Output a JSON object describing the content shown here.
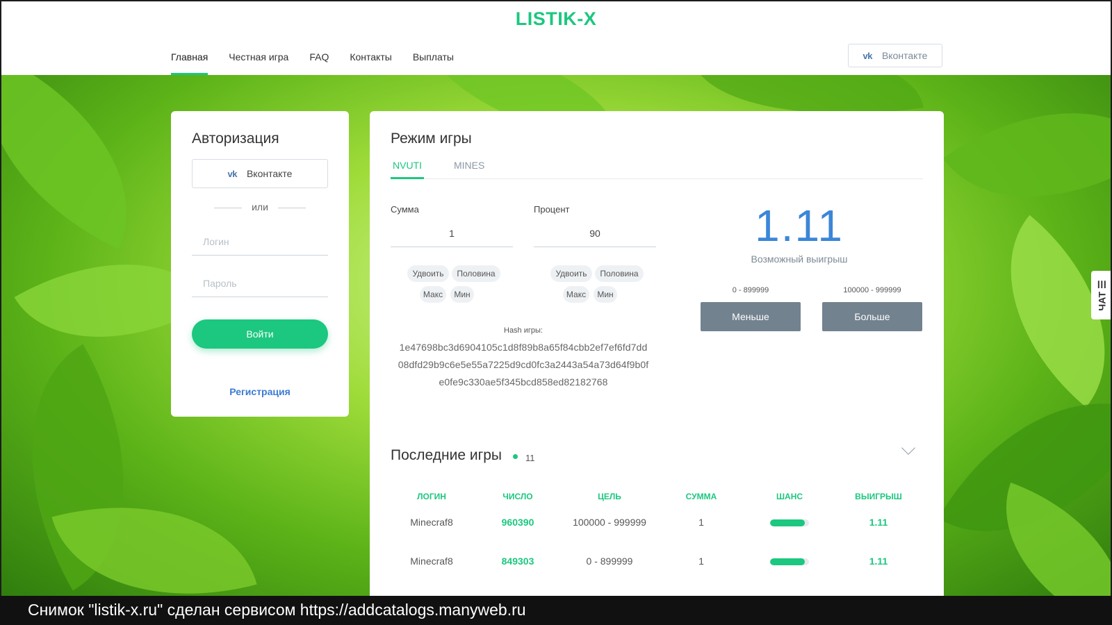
{
  "header": {
    "logo": "LISTIK-X",
    "nav": [
      "Главная",
      "Честная игра",
      "FAQ",
      "Контакты",
      "Выплаты"
    ],
    "vk_button": "Вконтакте",
    "vk_icon": "vk-icon"
  },
  "auth": {
    "title": "Авторизация",
    "vk_button": "Вконтакте",
    "or": "или",
    "login_placeholder": "Логин",
    "password_placeholder": "Пароль",
    "submit": "Войти",
    "register": "Регистрация"
  },
  "game": {
    "title": "Режим игры",
    "tabs": [
      "NVUTI",
      "MINES"
    ],
    "sum_label": "Сумма",
    "sum_value": "1",
    "percent_label": "Процент",
    "percent_value": "90",
    "chips": {
      "double": "Удвоить",
      "half": "Половина",
      "max": "Макс",
      "min": "Мин"
    },
    "hash_title": "Hash игры:",
    "hash_lines": [
      "1e47698bc3d6904105c1d8f89b8a65f84cbb2ef7ef6fd7dd",
      "08dfd29b9c6e5e55a7225d9cd0fc3a2443a54a73d64f9b0f",
      "e0fe9c330ae5f345bcd858ed82182768"
    ],
    "multiplier": "1.11",
    "possible_win": "Возможный выигрыш",
    "less_range": "0 - 899999",
    "more_range": "100000 - 999999",
    "less_button": "Меньше",
    "more_button": "Больше"
  },
  "recent": {
    "title": "Последние игры",
    "count": "11",
    "columns": [
      "ЛОГИН",
      "ЧИСЛО",
      "ЦЕЛЬ",
      "СУММА",
      "ШАНС",
      "ВЫИГРЫШ"
    ],
    "rows": [
      {
        "login": "Minecraf8",
        "number": "960390",
        "target": "100000 - 999999",
        "sum": "1",
        "chance": 0.9,
        "win": "1.11"
      },
      {
        "login": "Minecraf8",
        "number": "849303",
        "target": "0 - 899999",
        "sum": "1",
        "chance": 0.9,
        "win": "1.11"
      }
    ]
  },
  "chat": "ЧАТ ☰",
  "footer": "Снимок \"listik-x.ru\" сделан сервисом https://addcatalogs.manyweb.ru",
  "colors": {
    "accent": "#1cc77f",
    "multiplier": "#3b86d8",
    "button_gray": "#72828f",
    "link": "#3b7bd3"
  }
}
